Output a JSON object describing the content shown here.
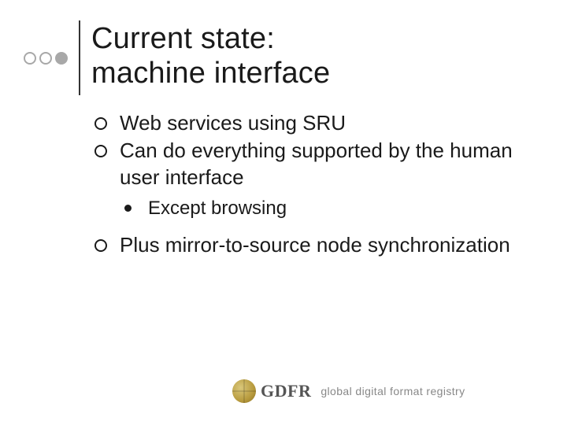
{
  "title": "Current state:\nmachine interface",
  "bullets": [
    {
      "text": "Web services using SRU"
    },
    {
      "text": "Can do everything supported by the human user interface",
      "sub": [
        {
          "text": "Except browsing"
        }
      ]
    },
    {
      "text": "Plus mirror-to-source node synchronization"
    }
  ],
  "footer": {
    "logo_text": "GDFR",
    "tagline": "global digital format registry"
  }
}
